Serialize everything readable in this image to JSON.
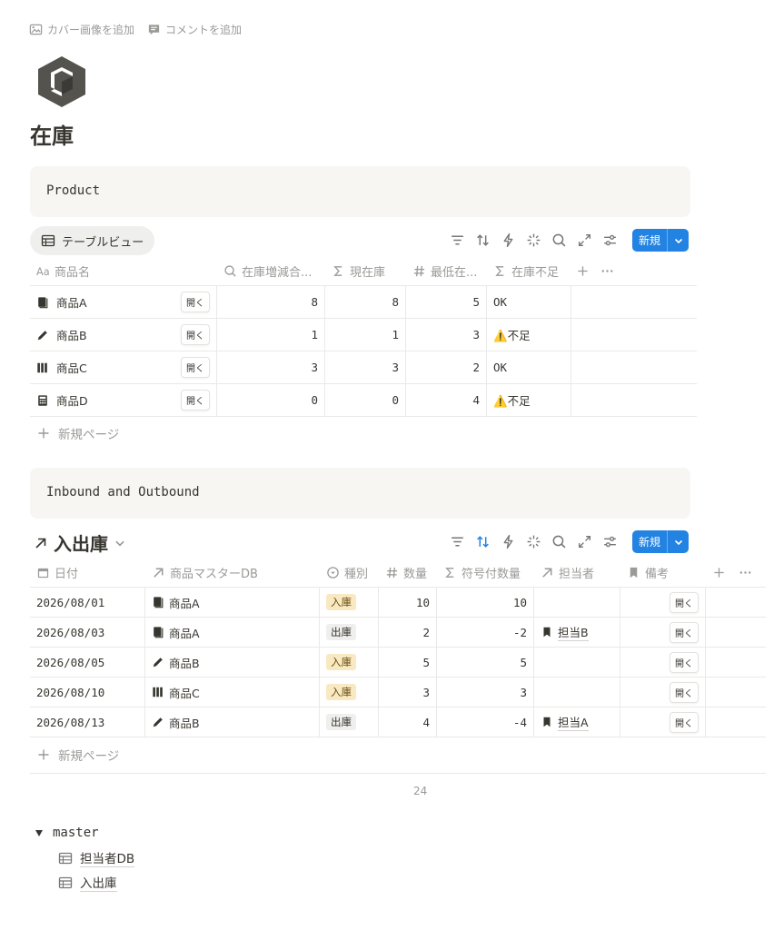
{
  "top_actions": {
    "add_cover": "カバー画像を追加",
    "add_comment": "コメントを追加"
  },
  "page": {
    "title": "在庫"
  },
  "product_block": {
    "code_text": "Product"
  },
  "product_view": {
    "tab_label": "テーブルビュー",
    "new_label": "新規",
    "columns": [
      "商品名",
      "在庫増減合...",
      "現在庫",
      "最低在...",
      "在庫不足"
    ],
    "rows": [
      {
        "icon": "book-icon",
        "name": "商品A",
        "open": "開く",
        "delta": "8",
        "stock": "8",
        "min": "5",
        "shortage": "OK"
      },
      {
        "icon": "pencil-icon",
        "name": "商品B",
        "open": "開く",
        "delta": "1",
        "stock": "1",
        "min": "3",
        "shortage": "⚠️不足"
      },
      {
        "icon": "books-icon",
        "name": "商品C",
        "open": "開く",
        "delta": "3",
        "stock": "3",
        "min": "2",
        "shortage": "OK"
      },
      {
        "icon": "calculator-icon",
        "name": "商品D",
        "open": "開く",
        "delta": "0",
        "stock": "0",
        "min": "4",
        "shortage": "⚠️不足"
      }
    ],
    "new_page": "新規ページ"
  },
  "inout_block": {
    "code_text": "Inbound and Outbound"
  },
  "inout_view": {
    "title": "入出庫",
    "new_label": "新規",
    "columns": [
      "日付",
      "商品マスターDB",
      "種別",
      "数量",
      "符号付数量",
      "担当者",
      "備考"
    ],
    "rows": [
      {
        "date": "2026/08/01",
        "icon": "book-icon",
        "product": "商品A",
        "type": "入庫",
        "type_kind": "in",
        "qty": "10",
        "signed": "10",
        "person": "",
        "open": "開く"
      },
      {
        "date": "2026/08/03",
        "icon": "book-icon",
        "product": "商品A",
        "type": "出庫",
        "type_kind": "out",
        "qty": "2",
        "signed": "-2",
        "person": "担当B",
        "open": "開く"
      },
      {
        "date": "2026/08/05",
        "icon": "pencil-icon",
        "product": "商品B",
        "type": "入庫",
        "type_kind": "in",
        "qty": "5",
        "signed": "5",
        "person": "",
        "open": "開く"
      },
      {
        "date": "2026/08/10",
        "icon": "books-icon",
        "product": "商品C",
        "type": "入庫",
        "type_kind": "in",
        "qty": "3",
        "signed": "3",
        "person": "",
        "open": "開く"
      },
      {
        "date": "2026/08/13",
        "icon": "pencil-icon",
        "product": "商品B",
        "type": "出庫",
        "type_kind": "out",
        "qty": "4",
        "signed": "-4",
        "person": "担当A",
        "open": "開く"
      }
    ],
    "new_page": "新規ページ",
    "count": "24"
  },
  "toggle": {
    "label": "master",
    "children": [
      {
        "label": "担当者DB"
      },
      {
        "label": "入出庫"
      }
    ]
  },
  "colors": {
    "accent": "#2383e2",
    "tag_in_bg": "#f9e9c2",
    "tag_out_bg": "#efefed"
  }
}
